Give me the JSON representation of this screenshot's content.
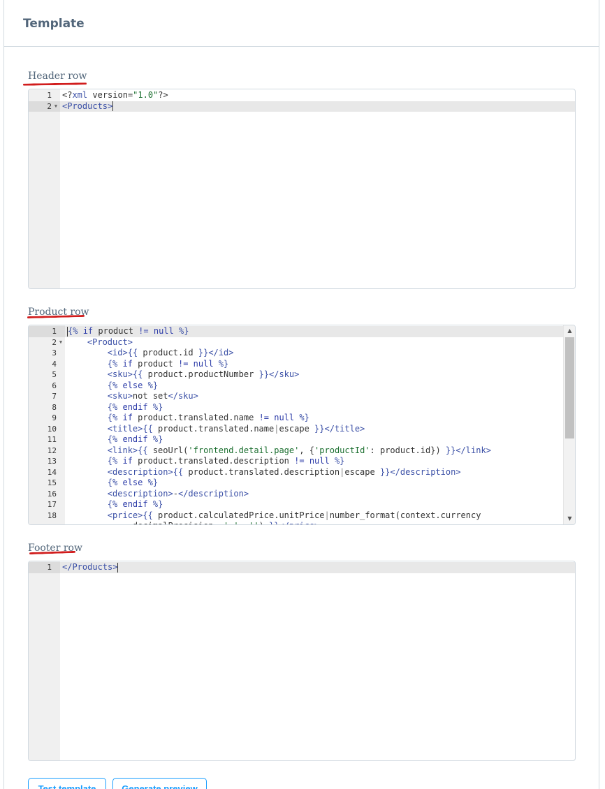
{
  "card": {
    "title": "Template"
  },
  "header_row": {
    "label": "Header row",
    "lines": [
      {
        "num": "1",
        "html": "&lt;?<span class=\"tag\">xml</span> version=<span class=\"str\">\"1.0\"</span>?&gt;"
      },
      {
        "num": "2",
        "html": "<span class=\"tag\">&lt;Products&gt;</span>",
        "fold": true,
        "active": true,
        "cursor": true
      }
    ]
  },
  "product_row": {
    "label": "Product row",
    "lines": [
      {
        "num": "1",
        "html": "<span class=\"ctrl\">{%</span> <span class=\"kw\">if</span> product <span class=\"kw\">!=</span> <span class=\"kw\">null</span> <span class=\"ctrl\">%}</span>",
        "active": true,
        "cursor_start": true
      },
      {
        "num": "2",
        "html": "    <span class=\"tag\">&lt;Product&gt;</span>",
        "fold": true
      },
      {
        "num": "3",
        "html": "        <span class=\"tag\">&lt;id&gt;</span><span class=\"ctrl\">{{</span> product.id <span class=\"ctrl\">}}</span><span class=\"tag\">&lt;/id&gt;</span>"
      },
      {
        "num": "4",
        "html": "        <span class=\"ctrl\">{%</span> <span class=\"kw\">if</span> product <span class=\"kw\">!=</span> <span class=\"kw\">null</span> <span class=\"ctrl\">%}</span>"
      },
      {
        "num": "5",
        "html": "        <span class=\"tag\">&lt;sku&gt;</span><span class=\"ctrl\">{{</span> product.productNumber <span class=\"ctrl\">}}</span><span class=\"tag\">&lt;/sku&gt;</span>"
      },
      {
        "num": "6",
        "html": "        <span class=\"ctrl\">{%</span> <span class=\"kw\">else</span> <span class=\"ctrl\">%}</span>"
      },
      {
        "num": "7",
        "html": "        <span class=\"tag\">&lt;sku&gt;</span>not set<span class=\"tag\">&lt;/sku&gt;</span>"
      },
      {
        "num": "8",
        "html": "        <span class=\"ctrl\">{%</span> <span class=\"kw\">endif</span> <span class=\"ctrl\">%}</span>"
      },
      {
        "num": "9",
        "html": "        <span class=\"ctrl\">{%</span> <span class=\"kw\">if</span> product.translated.name <span class=\"kw\">!=</span> <span class=\"kw\">null</span> <span class=\"ctrl\">%}</span>"
      },
      {
        "num": "10",
        "html": "        <span class=\"tag\">&lt;title&gt;</span><span class=\"ctrl\">{{</span> product.translated.name<span class=\"pipe\">|</span>escape <span class=\"ctrl\">}}</span><span class=\"tag\">&lt;/title&gt;</span>"
      },
      {
        "num": "11",
        "html": "        <span class=\"ctrl\">{%</span> <span class=\"kw\">endif</span> <span class=\"ctrl\">%}</span>"
      },
      {
        "num": "12",
        "html": "        <span class=\"tag\">&lt;link&gt;</span><span class=\"ctrl\">{{</span> seoUrl(<span class=\"str\">'frontend.detail.page'</span>, {<span class=\"str\">'productId'</span>: product.id}) <span class=\"ctrl\">}}</span><span class=\"tag\">&lt;/link&gt;</span>"
      },
      {
        "num": "13",
        "html": "        <span class=\"ctrl\">{%</span> <span class=\"kw\">if</span> product.translated.description <span class=\"kw\">!=</span> <span class=\"kw\">null</span> <span class=\"ctrl\">%}</span>"
      },
      {
        "num": "14",
        "html": "        <span class=\"tag\">&lt;description&gt;</span><span class=\"ctrl\">{{</span> product.translated.description<span class=\"pipe\">|</span>escape <span class=\"ctrl\">}}</span><span class=\"tag\">&lt;/description&gt;</span>"
      },
      {
        "num": "15",
        "html": "        <span class=\"ctrl\">{%</span> <span class=\"kw\">else</span> <span class=\"ctrl\">%}</span>"
      },
      {
        "num": "16",
        "html": "        <span class=\"tag\">&lt;description&gt;</span>-<span class=\"tag\">&lt;/description&gt;</span>"
      },
      {
        "num": "17",
        "html": "        <span class=\"ctrl\">{%</span> <span class=\"kw\">endif</span> <span class=\"ctrl\">%}</span>"
      },
      {
        "num": "18",
        "html": "        <span class=\"tag\">&lt;price&gt;</span><span class=\"ctrl\">{{</span> product.calculatedPrice.unitPrice<span class=\"pipe\">|</span>number_format(context.currency"
      },
      {
        "num": "",
        "html": "            .decimalPrecision, <span class=\"str\">'.'</span>, <span class=\"str\">''</span>) <span class=\"ctrl\">}}</span><span class=\"tag\">&lt;/price&gt;</span>"
      }
    ]
  },
  "footer_row": {
    "label": "Footer row",
    "lines": [
      {
        "num": "1",
        "html": "<span class=\"tag\">&lt;/Products&gt;</span>",
        "active": true,
        "cursor": true
      }
    ]
  },
  "buttons": {
    "test_label": "Test template",
    "preview_label": "Generate preview"
  },
  "colors": {
    "accent": "#189eff",
    "annotation": "#d11d1d"
  }
}
